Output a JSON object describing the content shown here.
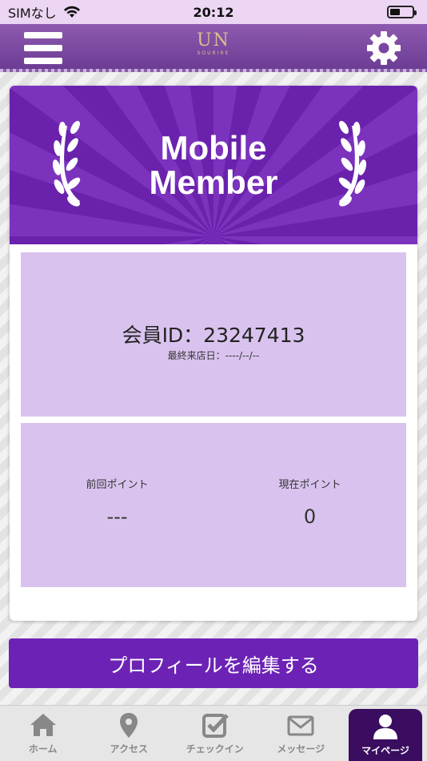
{
  "status_bar": {
    "carrier": "SIMなし",
    "time": "20:12"
  },
  "header": {
    "logo_text": "UN",
    "logo_subtext": "SOURIRE"
  },
  "banner": {
    "title_line1": "Mobile",
    "title_line2": "Member"
  },
  "member": {
    "id_text": "会員ID：23247413",
    "last_visit_text": "最終来店日：----/--/--"
  },
  "points": {
    "previous_label": "前回ポイント",
    "previous_value": "---",
    "current_label": "現在ポイント",
    "current_value": "0"
  },
  "edit_profile_label": "プロフィールを編集する",
  "tabs": [
    {
      "label": "ホーム",
      "icon": "home-icon"
    },
    {
      "label": "アクセス",
      "icon": "map-pin-icon"
    },
    {
      "label": "チェックイン",
      "icon": "checkbox-icon"
    },
    {
      "label": "メッセージ",
      "icon": "envelope-icon"
    },
    {
      "label": "マイページ",
      "icon": "user-icon"
    }
  ],
  "colors": {
    "brand_purple": "#6c23b5",
    "panel_lavender": "#d9c3ee",
    "active_tab": "#3a0d60"
  }
}
